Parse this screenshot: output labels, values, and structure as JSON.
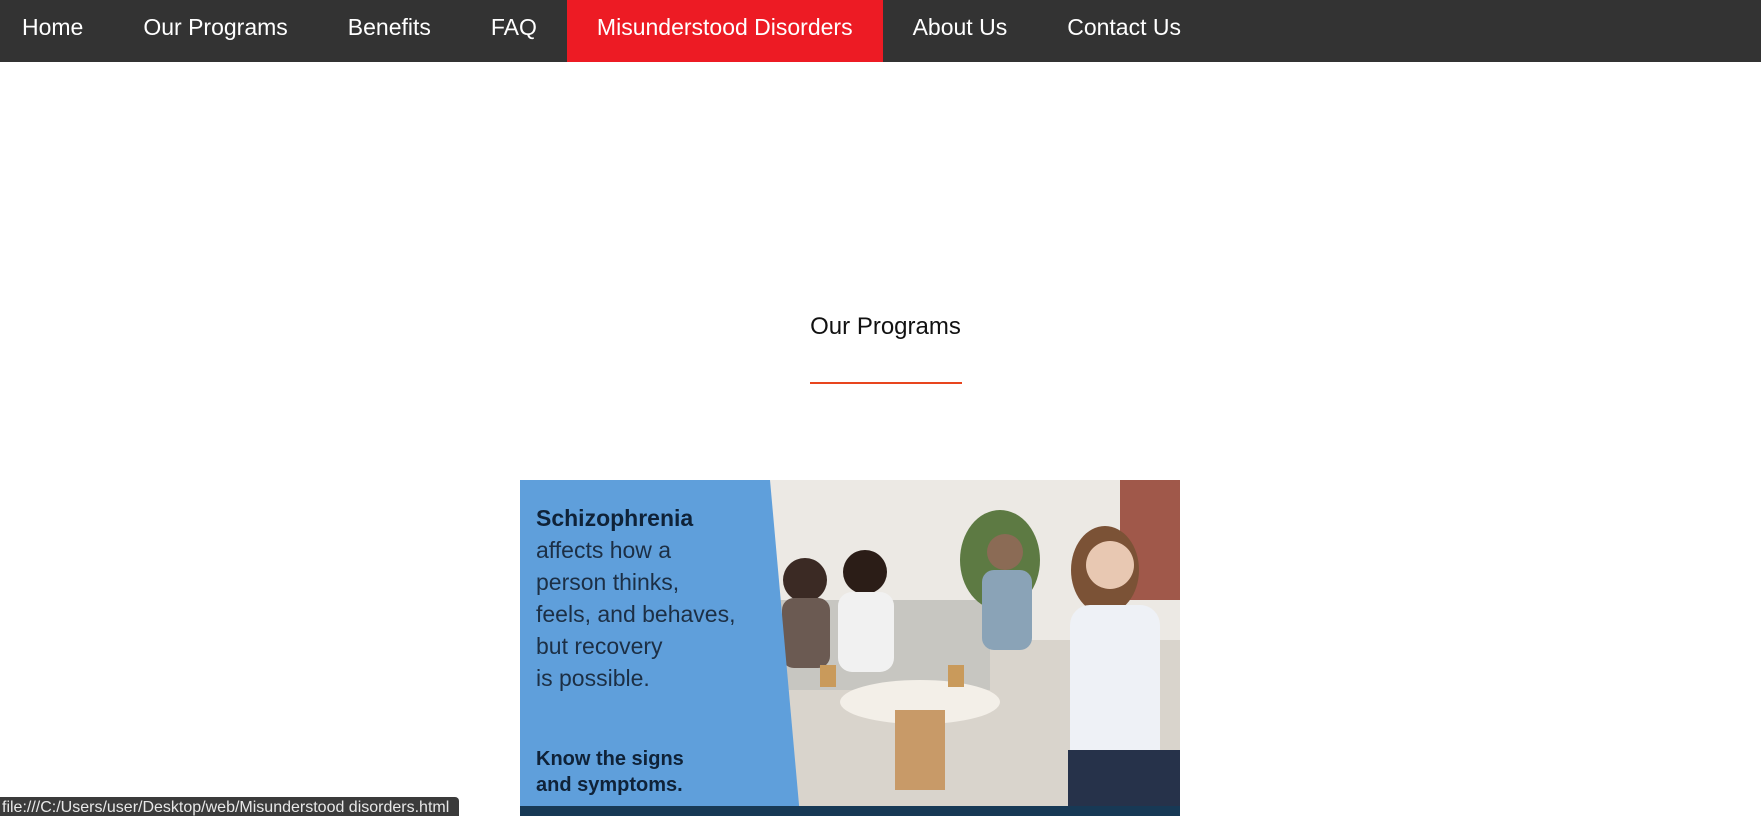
{
  "nav": {
    "items": [
      {
        "label": "Home",
        "active": false
      },
      {
        "label": "Our Programs",
        "active": false
      },
      {
        "label": "Benefits",
        "active": false
      },
      {
        "label": "FAQ",
        "active": false
      },
      {
        "label": "Misunderstood Disorders",
        "active": true
      },
      {
        "label": "About Us",
        "active": false
      },
      {
        "label": "Contact Us",
        "active": false
      }
    ],
    "background_color": "#333333",
    "active_color": "#ed1b24"
  },
  "section": {
    "title": "Our Programs",
    "underline_color": "#e8451e"
  },
  "program_image": {
    "headline_bold": "Schizophrenia",
    "headline_lines": [
      "affects how a",
      "person thinks,",
      "feels, and behaves,",
      "but recovery",
      "is possible."
    ],
    "cta_lines": [
      "Know the signs",
      "and symptoms."
    ],
    "panel_color": "#5f9fdb"
  },
  "status_bar": {
    "url": "file:///C:/Users/user/Desktop/web/Misunderstood disorders.html"
  }
}
